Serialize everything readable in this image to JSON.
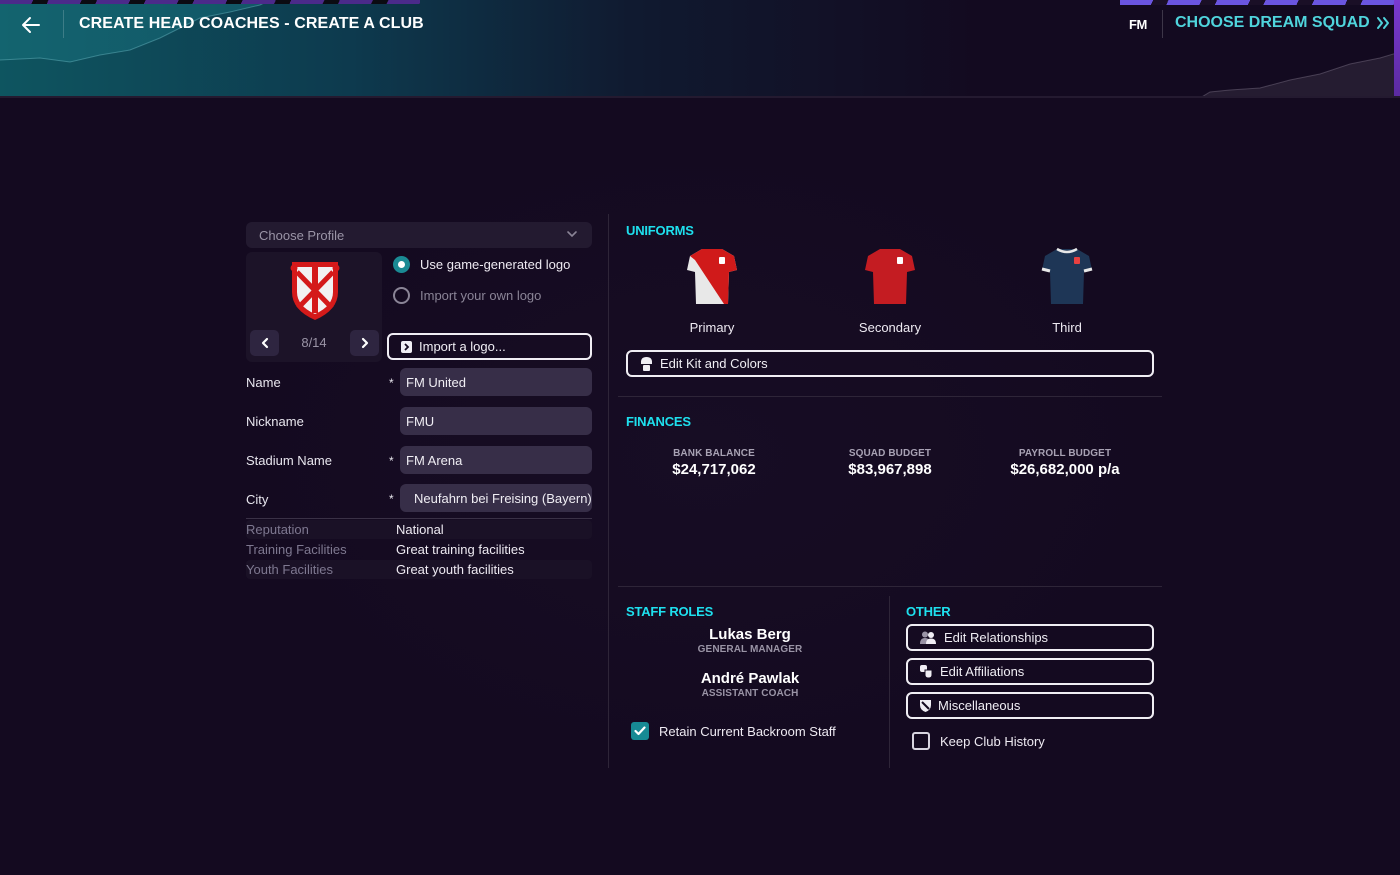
{
  "header": {
    "title": "CREATE HEAD COACHES - CREATE A CLUB",
    "brand": "FM",
    "next_label": "CHOOSE DREAM SQUAD",
    "next_icon": "double-chevron-right-icon",
    "back_icon": "arrow-left-icon"
  },
  "profile": {
    "placeholder": "Choose Profile",
    "icon": "chevron-down-icon"
  },
  "logo": {
    "counter": "8/14",
    "options": [
      {
        "label": "Use game-generated logo",
        "selected": true
      },
      {
        "label": "Import your own logo",
        "selected": false
      }
    ],
    "import_button": "Import a logo..."
  },
  "fields": [
    {
      "label": "Name",
      "required": true,
      "value": "FM United"
    },
    {
      "label": "Nickname",
      "required": false,
      "value": "FMU"
    },
    {
      "label": "Stadium Name",
      "required": true,
      "value": "FM Arena"
    },
    {
      "label": "City",
      "required": true,
      "value": "Neufahrn bei Freising (Bayern)"
    }
  ],
  "required_marker": "*",
  "info": [
    {
      "label": "Reputation",
      "value": "National"
    },
    {
      "label": "Training Facilities",
      "value": "Great training facilities"
    },
    {
      "label": "Youth Facilities",
      "value": "Great youth facilities"
    }
  ],
  "uniforms": {
    "title": "UNIFORMS",
    "kits": [
      {
        "label": "Primary",
        "colors": [
          "#d01a1a",
          "#e8e8e8"
        ]
      },
      {
        "label": "Secondary",
        "colors": [
          "#c41c22"
        ]
      },
      {
        "label": "Third",
        "colors": [
          "#1e3656",
          "#e8e8e8"
        ]
      }
    ],
    "edit_button": "Edit Kit and Colors"
  },
  "finances": {
    "title": "FINANCES",
    "items": [
      {
        "label": "BANK BALANCE",
        "value": "$24,717,062"
      },
      {
        "label": "SQUAD BUDGET",
        "value": "$83,967,898"
      },
      {
        "label": "PAYROLL BUDGET",
        "value": "$26,682,000 p/a"
      }
    ]
  },
  "staff": {
    "title": "STAFF ROLES",
    "members": [
      {
        "name": "Lukas Berg",
        "role": "GENERAL MANAGER"
      },
      {
        "name": "André Pawlak",
        "role": "ASSISTANT COACH"
      }
    ],
    "retain_label": "Retain Current Backroom Staff",
    "retain_checked": true
  },
  "other": {
    "title": "OTHER",
    "buttons": [
      {
        "label": "Edit Relationships",
        "icon": "people-icon"
      },
      {
        "label": "Edit Affiliations",
        "icon": "affiliations-icon"
      },
      {
        "label": "Miscellaneous",
        "icon": "shield-icon"
      }
    ],
    "keep_history_label": "Keep Club History",
    "keep_history_checked": false
  },
  "colors": {
    "accent": "#1ee0ee",
    "link": "#4fd4dc",
    "background": "#140a20",
    "toggle_on": "#178a94"
  }
}
